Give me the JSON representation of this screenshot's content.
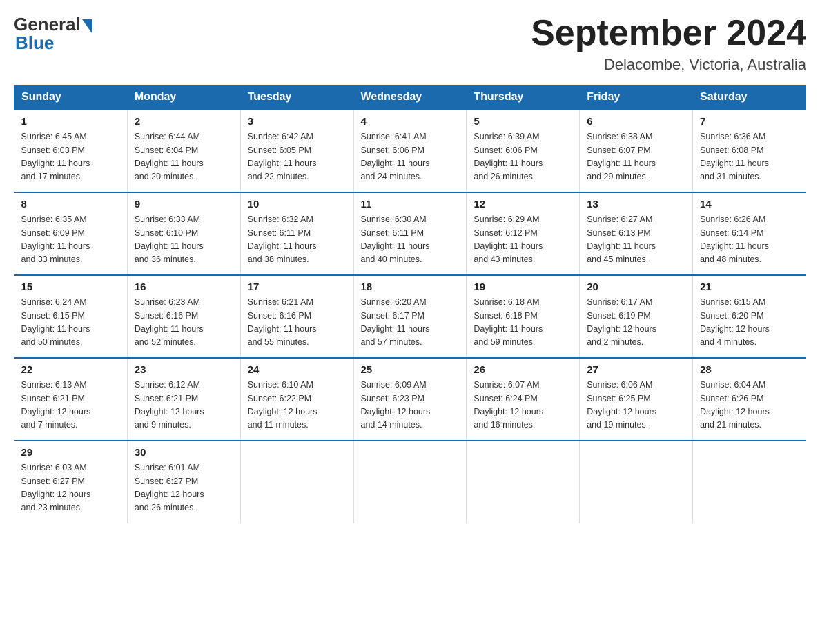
{
  "header": {
    "logo_general": "General",
    "logo_blue": "Blue",
    "title": "September 2024",
    "subtitle": "Delacombe, Victoria, Australia"
  },
  "days_of_week": [
    "Sunday",
    "Monday",
    "Tuesday",
    "Wednesday",
    "Thursday",
    "Friday",
    "Saturday"
  ],
  "weeks": [
    [
      {
        "day": "1",
        "sunrise": "6:45 AM",
        "sunset": "6:03 PM",
        "daylight": "11 hours and 17 minutes."
      },
      {
        "day": "2",
        "sunrise": "6:44 AM",
        "sunset": "6:04 PM",
        "daylight": "11 hours and 20 minutes."
      },
      {
        "day": "3",
        "sunrise": "6:42 AM",
        "sunset": "6:05 PM",
        "daylight": "11 hours and 22 minutes."
      },
      {
        "day": "4",
        "sunrise": "6:41 AM",
        "sunset": "6:06 PM",
        "daylight": "11 hours and 24 minutes."
      },
      {
        "day": "5",
        "sunrise": "6:39 AM",
        "sunset": "6:06 PM",
        "daylight": "11 hours and 26 minutes."
      },
      {
        "day": "6",
        "sunrise": "6:38 AM",
        "sunset": "6:07 PM",
        "daylight": "11 hours and 29 minutes."
      },
      {
        "day": "7",
        "sunrise": "6:36 AM",
        "sunset": "6:08 PM",
        "daylight": "11 hours and 31 minutes."
      }
    ],
    [
      {
        "day": "8",
        "sunrise": "6:35 AM",
        "sunset": "6:09 PM",
        "daylight": "11 hours and 33 minutes."
      },
      {
        "day": "9",
        "sunrise": "6:33 AM",
        "sunset": "6:10 PM",
        "daylight": "11 hours and 36 minutes."
      },
      {
        "day": "10",
        "sunrise": "6:32 AM",
        "sunset": "6:11 PM",
        "daylight": "11 hours and 38 minutes."
      },
      {
        "day": "11",
        "sunrise": "6:30 AM",
        "sunset": "6:11 PM",
        "daylight": "11 hours and 40 minutes."
      },
      {
        "day": "12",
        "sunrise": "6:29 AM",
        "sunset": "6:12 PM",
        "daylight": "11 hours and 43 minutes."
      },
      {
        "day": "13",
        "sunrise": "6:27 AM",
        "sunset": "6:13 PM",
        "daylight": "11 hours and 45 minutes."
      },
      {
        "day": "14",
        "sunrise": "6:26 AM",
        "sunset": "6:14 PM",
        "daylight": "11 hours and 48 minutes."
      }
    ],
    [
      {
        "day": "15",
        "sunrise": "6:24 AM",
        "sunset": "6:15 PM",
        "daylight": "11 hours and 50 minutes."
      },
      {
        "day": "16",
        "sunrise": "6:23 AM",
        "sunset": "6:16 PM",
        "daylight": "11 hours and 52 minutes."
      },
      {
        "day": "17",
        "sunrise": "6:21 AM",
        "sunset": "6:16 PM",
        "daylight": "11 hours and 55 minutes."
      },
      {
        "day": "18",
        "sunrise": "6:20 AM",
        "sunset": "6:17 PM",
        "daylight": "11 hours and 57 minutes."
      },
      {
        "day": "19",
        "sunrise": "6:18 AM",
        "sunset": "6:18 PM",
        "daylight": "11 hours and 59 minutes."
      },
      {
        "day": "20",
        "sunrise": "6:17 AM",
        "sunset": "6:19 PM",
        "daylight": "12 hours and 2 minutes."
      },
      {
        "day": "21",
        "sunrise": "6:15 AM",
        "sunset": "6:20 PM",
        "daylight": "12 hours and 4 minutes."
      }
    ],
    [
      {
        "day": "22",
        "sunrise": "6:13 AM",
        "sunset": "6:21 PM",
        "daylight": "12 hours and 7 minutes."
      },
      {
        "day": "23",
        "sunrise": "6:12 AM",
        "sunset": "6:21 PM",
        "daylight": "12 hours and 9 minutes."
      },
      {
        "day": "24",
        "sunrise": "6:10 AM",
        "sunset": "6:22 PM",
        "daylight": "12 hours and 11 minutes."
      },
      {
        "day": "25",
        "sunrise": "6:09 AM",
        "sunset": "6:23 PM",
        "daylight": "12 hours and 14 minutes."
      },
      {
        "day": "26",
        "sunrise": "6:07 AM",
        "sunset": "6:24 PM",
        "daylight": "12 hours and 16 minutes."
      },
      {
        "day": "27",
        "sunrise": "6:06 AM",
        "sunset": "6:25 PM",
        "daylight": "12 hours and 19 minutes."
      },
      {
        "day": "28",
        "sunrise": "6:04 AM",
        "sunset": "6:26 PM",
        "daylight": "12 hours and 21 minutes."
      }
    ],
    [
      {
        "day": "29",
        "sunrise": "6:03 AM",
        "sunset": "6:27 PM",
        "daylight": "12 hours and 23 minutes."
      },
      {
        "day": "30",
        "sunrise": "6:01 AM",
        "sunset": "6:27 PM",
        "daylight": "12 hours and 26 minutes."
      },
      null,
      null,
      null,
      null,
      null
    ]
  ],
  "labels": {
    "sunrise": "Sunrise:",
    "sunset": "Sunset:",
    "daylight": "Daylight:"
  }
}
